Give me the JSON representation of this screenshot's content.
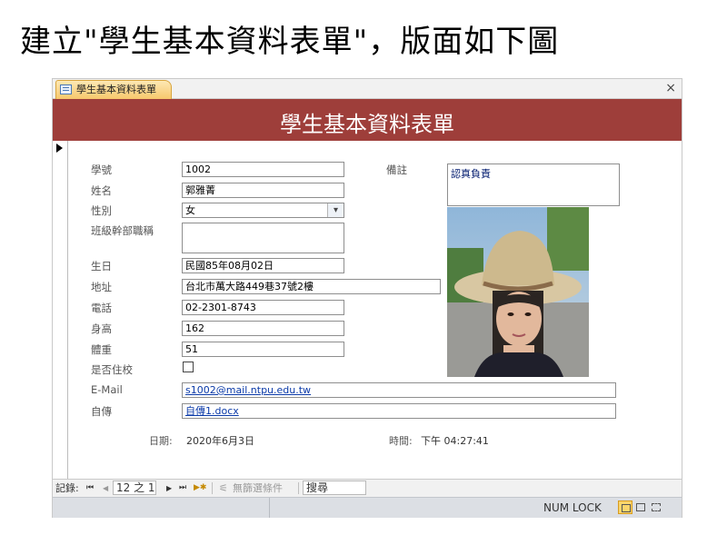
{
  "slide_title": "建立\"學生基本資料表單\"，版面如下圖",
  "window": {
    "tab_label": "學生基本資料表單",
    "close_glyph": "×",
    "form_title": "學生基本資料表單"
  },
  "fields": {
    "student_id": {
      "label": "學號",
      "value": "1002"
    },
    "name": {
      "label": "姓名",
      "value": "郭雅菁"
    },
    "gender": {
      "label": "性別",
      "value": "女",
      "dropdown_glyph": "▾"
    },
    "class_officer": {
      "label": "班級幹部職稱",
      "value": ""
    },
    "birthday": {
      "label": "生日",
      "value": "民國85年08月02日"
    },
    "address": {
      "label": "地址",
      "value": "台北市萬大路449巷37號2樓"
    },
    "phone": {
      "label": "電話",
      "value": "02-2301-8743"
    },
    "height": {
      "label": "身高",
      "value": "162"
    },
    "weight": {
      "label": "體重",
      "value": "51"
    },
    "lives_on_campus": {
      "label": "是否住校",
      "checked": false
    },
    "email": {
      "label": "E-Mail",
      "value": "s1002@mail.ntpu.edu.tw"
    },
    "autobiography": {
      "label": "自傳",
      "value": "自傳1.docx"
    },
    "notes": {
      "label": "備註",
      "value": "認真負責"
    }
  },
  "footer": {
    "date_label": "日期:",
    "date_value": "2020年6月3日",
    "time_label": "時間:",
    "time_value": "下午 04:27:41"
  },
  "navigation": {
    "record_label": "記錄:",
    "first": "⏮",
    "prev": "◀",
    "record_position": "12 之 1",
    "next": "▶",
    "last": "⏭",
    "new": "▶✱",
    "filter_label": "無篩選條件",
    "search_label": "搜尋"
  },
  "statusbar": {
    "numlock": "NUM LOCK"
  },
  "colors": {
    "header_band": "#9e3e3a",
    "tab_active": "#f7c86c"
  }
}
